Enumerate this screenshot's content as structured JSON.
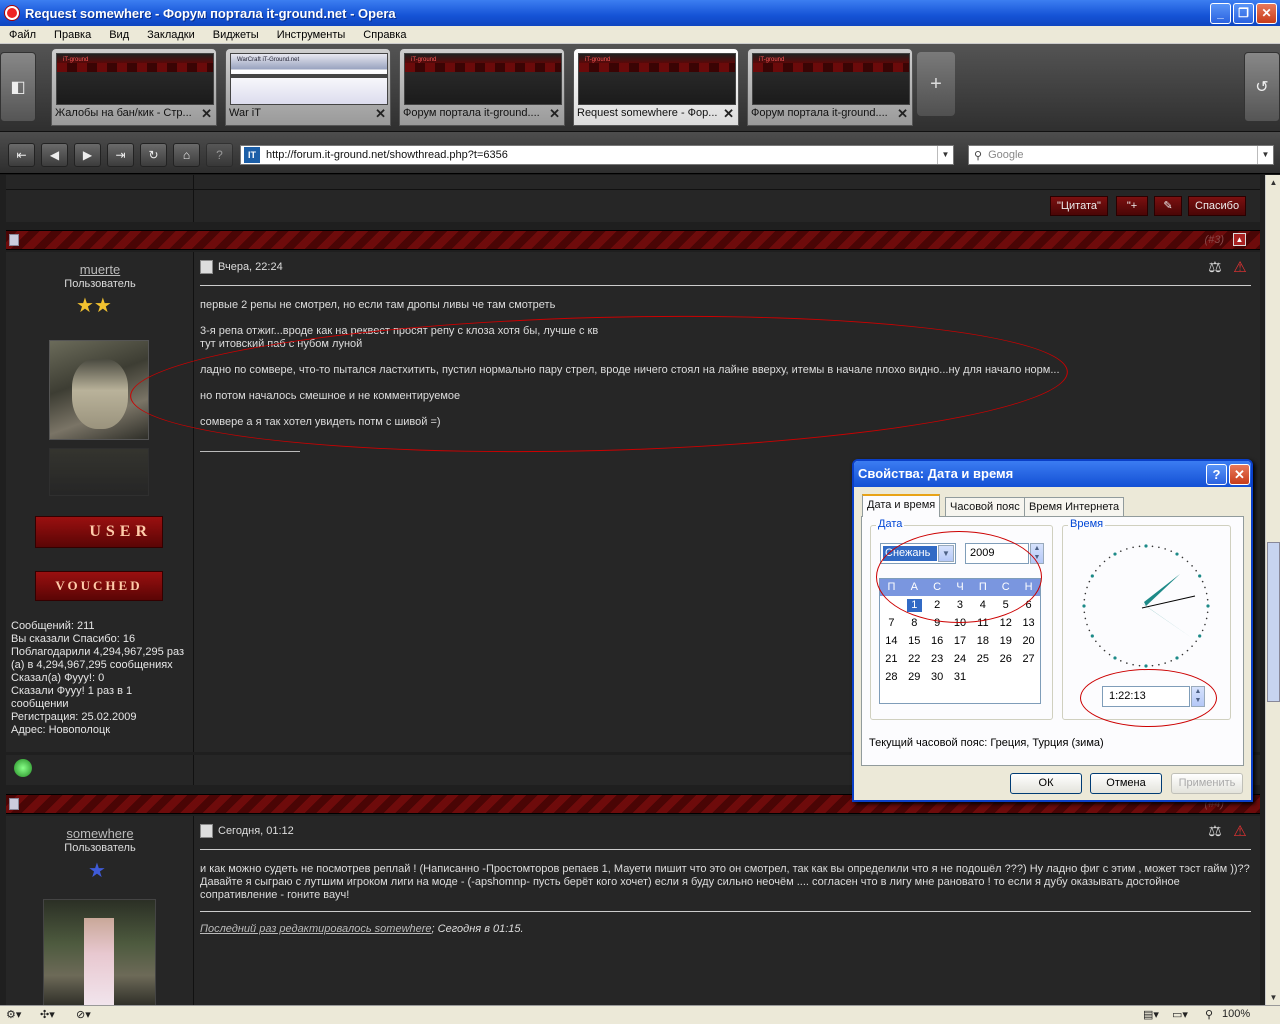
{
  "window": {
    "title": "Request somewhere - Форум портала it-ground.net - Opera"
  },
  "menu": [
    "Файл",
    "Правка",
    "Вид",
    "Закладки",
    "Виджеты",
    "Инструменты",
    "Справка"
  ],
  "tabs": [
    {
      "label": "Жалобы на бан/кик - Стр..."
    },
    {
      "label": "War iT"
    },
    {
      "label": "Форум портала it-ground...."
    },
    {
      "label": "Request somewhere - Фор..."
    },
    {
      "label": "Форум портала it-ground...."
    }
  ],
  "address": {
    "url": "http://forum.it-ground.net/showthread.php?t=6356",
    "search_placeholder": "Google",
    "favicon": "IT"
  },
  "toolbar": {
    "quote": "\"Цитата\"",
    "multiquote": "\"+",
    "thanks": "Спасибо"
  },
  "posts": [
    {
      "number": "(#3)",
      "username": "muerte",
      "role": "Пользователь",
      "date": "Вчера, 22:24",
      "lines": [
        "первые 2 репы не смотрел, но если там дропы ливы че там смотреть",
        "3-я репа отжиг...вроде как на реквест просят репу с клоза хотя бы, лучше с кв",
        "тут итовский паб с нубом луной",
        "ладно по сомвере, что-то пытался ластхитить, пустил нормально пару стрел, вроде ничего стоял на лайне вверху, итемы в начале плохо видно...ну для начало норм...",
        "но потом началось смешное и не комментируемое",
        "сомвере а я так хотел увидеть потм с шивой =)"
      ],
      "stats": [
        "Сообщений: 211",
        "Вы сказали Спасибо: 16",
        "Поблагодарили 4,294,967,295 раз (а) в 4,294,967,295 сообщениях",
        "Сказал(а) Фууу!: 0",
        "Сказали Фууу! 1 раз в 1 сообщении",
        "Регистрация: 25.02.2009",
        "Адрес: Новополоцк"
      ],
      "badges": [
        "USER",
        "VOUCHED"
      ]
    },
    {
      "number": "(#4)",
      "username": "somewhere",
      "role": "Пользователь",
      "date": "Сегодня, 01:12",
      "lines": [
        "и как можно судеть не посмотрев реплай ! (Написанно -Простомторов репаев 1, Мауети пишит что это он смотрел, так как вы определили что я не подошёл ???) Ну ладно фиг с этим , может тэст гайм ))??",
        "Давайте я сыграю с лутшим игроком лиги на моде - (-apshomnp- пусть берёт кого хочет) если я буду сильно неочём .... согласен что в лигу мне рановато ! то если я дубу оказывать достойное",
        "сопративление - гоните вауч!"
      ],
      "edited_link": "Последний раз редактировалось somewhere",
      "edited_time": "; Сегодня в 01:15."
    }
  ],
  "dialog": {
    "title": "Свойства: Дата и время",
    "tabs": [
      "Дата и время",
      "Часовой пояс",
      "Время Интернета"
    ],
    "date_group": "Дата",
    "time_group": "Время",
    "month": "Снежань",
    "year": "2009",
    "weekdays": [
      "П",
      "А",
      "С",
      "Ч",
      "П",
      "С",
      "Н"
    ],
    "days": [
      "",
      "1",
      "2",
      "3",
      "4",
      "5",
      "6",
      "7",
      "8",
      "9",
      "10",
      "11",
      "12",
      "13",
      "14",
      "15",
      "16",
      "17",
      "18",
      "19",
      "20",
      "21",
      "22",
      "23",
      "24",
      "25",
      "26",
      "27",
      "28",
      "29",
      "30",
      "31"
    ],
    "selected_day": "1",
    "time": "1:22:13",
    "timezone": "Текущий часовой пояс: Греция, Турция (зима)",
    "ok": "ОК",
    "cancel": "Отмена",
    "apply": "Применить"
  },
  "status": {
    "zoom": "100%"
  },
  "colors": {
    "accent": "#0a3fc8",
    "forum_bar": "#6e0b0b",
    "annotation": "#cc0000"
  }
}
